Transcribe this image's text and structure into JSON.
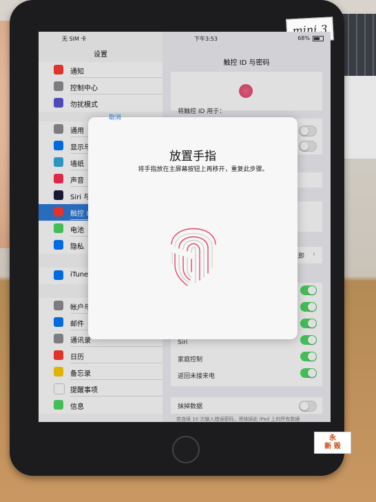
{
  "device": {
    "model_sticker": "mini 3",
    "shop_sticker": [
      "永",
      "新 毁"
    ]
  },
  "status_bar": {
    "carrier": "无 SIM 卡",
    "time": "下午3:53",
    "battery": "68%"
  },
  "master": {
    "title": "设置",
    "items": [
      {
        "label": "通知",
        "icon": "notification-icon",
        "color": "#ff3b30"
      },
      {
        "label": "控制中心",
        "icon": "control-center-icon",
        "color": "#8e8e93"
      },
      {
        "label": "勿扰模式",
        "icon": "moon-icon",
        "color": "#5856d6"
      },
      {
        "label": "通用",
        "icon": "gear-icon",
        "color": "#8e8e93"
      },
      {
        "label": "显示与",
        "icon": "display-icon",
        "color": "#007aff"
      },
      {
        "label": "墙纸",
        "icon": "wallpaper-icon",
        "color": "#34aadc"
      },
      {
        "label": "声音",
        "icon": "sound-icon",
        "color": "#ff2d55"
      },
      {
        "label": "Siri 与",
        "icon": "siri-icon",
        "color": "#1c1c3c"
      },
      {
        "label": "触控 ID",
        "icon": "fingerprint-icon",
        "color": "#ff3b30"
      },
      {
        "label": "电池",
        "icon": "battery-icon",
        "color": "#4cd964"
      },
      {
        "label": "隐私",
        "icon": "hand-icon",
        "color": "#007aff"
      },
      {
        "label": "iTunes",
        "icon": "app-store-icon",
        "color": "#007aff"
      },
      {
        "label": "帐户与",
        "icon": "key-icon",
        "color": "#8e8e93"
      },
      {
        "label": "邮件",
        "icon": "mail-icon",
        "color": "#007aff"
      },
      {
        "label": "通讯录",
        "icon": "contacts-icon",
        "color": "#8e8e93"
      },
      {
        "label": "日历",
        "icon": "calendar-icon",
        "color": "#ff3b30"
      },
      {
        "label": "备忘录",
        "icon": "notes-icon",
        "color": "#ffcc00"
      },
      {
        "label": "提醒事项",
        "icon": "reminders-icon",
        "color": "#ffffff"
      },
      {
        "label": "信息",
        "icon": "messages-icon",
        "color": "#4cd964"
      }
    ]
  },
  "detail": {
    "title": "触控 ID 与密码",
    "section_header": "将触控 ID 用于：",
    "link_text": "立即",
    "toggle_rows": [
      {
        "label": "Siri",
        "on": true
      },
      {
        "label": "家庭控制",
        "on": true
      },
      {
        "label": "返回未接来电",
        "on": true
      }
    ],
    "erase_label": "抹掉数据",
    "erase_footer": "若连续 10 次输入错误密码，将抹掉此 iPad 上的所有数据"
  },
  "modal": {
    "cancel_label": "取消",
    "title": "放置手指",
    "message": "将手指放在主屏幕按钮上再移开，重复此步骤。"
  }
}
